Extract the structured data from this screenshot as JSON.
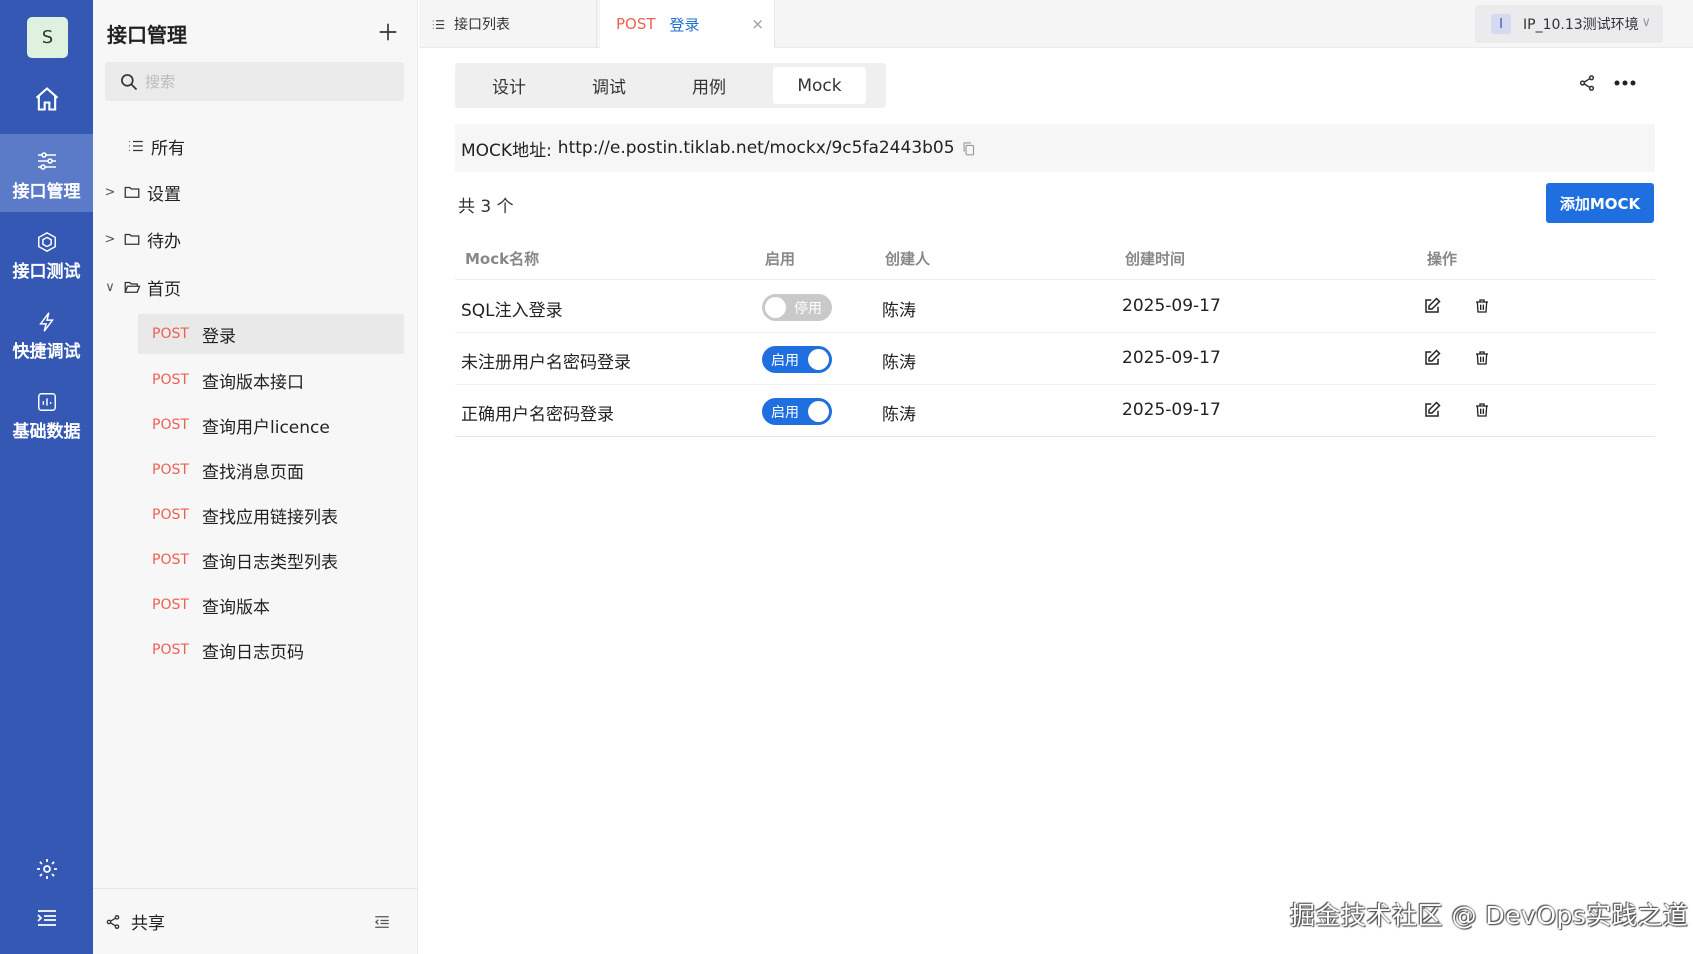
{
  "user": {
    "avatar_letter": "S"
  },
  "rail": {
    "items": [
      {
        "label": "接口管理",
        "icon": "sliders-icon"
      },
      {
        "label": "接口测试",
        "icon": "cube-icon"
      },
      {
        "label": "快捷调试",
        "icon": "lightning-icon"
      },
      {
        "label": "基础数据",
        "icon": "chart-icon"
      }
    ]
  },
  "tree": {
    "title": "接口管理",
    "search_placeholder": "搜索",
    "all_label": "所有",
    "folders": [
      {
        "label": "设置"
      },
      {
        "label": "待办"
      },
      {
        "label": "首页"
      }
    ],
    "apis": [
      {
        "method": "POST",
        "name": "登录"
      },
      {
        "method": "POST",
        "name": "查询版本接口"
      },
      {
        "method": "POST",
        "name": "查询用户licence"
      },
      {
        "method": "POST",
        "name": "查找消息页面"
      },
      {
        "method": "POST",
        "name": "查找应用链接列表"
      },
      {
        "method": "POST",
        "name": "查询日志类型列表"
      },
      {
        "method": "POST",
        "name": "查询版本"
      },
      {
        "method": "POST",
        "name": "查询日志页码"
      }
    ],
    "share_label": "共享"
  },
  "tabs": {
    "list_tab": "接口列表",
    "active_method": "POST",
    "active_name": "登录",
    "close": "×"
  },
  "env": {
    "badge": "I",
    "label": "IP_10.13测试环境"
  },
  "subtabs": [
    "设计",
    "调试",
    "用例",
    "Mock"
  ],
  "mock": {
    "url_label": "MOCK地址:",
    "url": "http://e.postin.tiklab.net/mockx/9c5fa2443b05",
    "total": "共 3 个",
    "add_button": "添加MOCK",
    "columns": [
      "Mock名称",
      "启用",
      "创建人",
      "创建时间",
      "操作"
    ],
    "rows": [
      {
        "name": "SQL注入登录",
        "enabled": false,
        "toggle_label": "停用",
        "creator": "陈涛",
        "created": "2025-09-17"
      },
      {
        "name": "未注册用户名密码登录",
        "enabled": true,
        "toggle_label": "启用",
        "creator": "陈涛",
        "created": "2025-09-17"
      },
      {
        "name": "正确用户名密码登录",
        "enabled": true,
        "toggle_label": "启用",
        "creator": "陈涛",
        "created": "2025-09-17"
      }
    ]
  },
  "watermark": "掘金技术社区 @ DevOps实践之道",
  "colors": {
    "rail": "#3458b3",
    "accent": "#1f6fe0",
    "post": "#ee5f51"
  }
}
